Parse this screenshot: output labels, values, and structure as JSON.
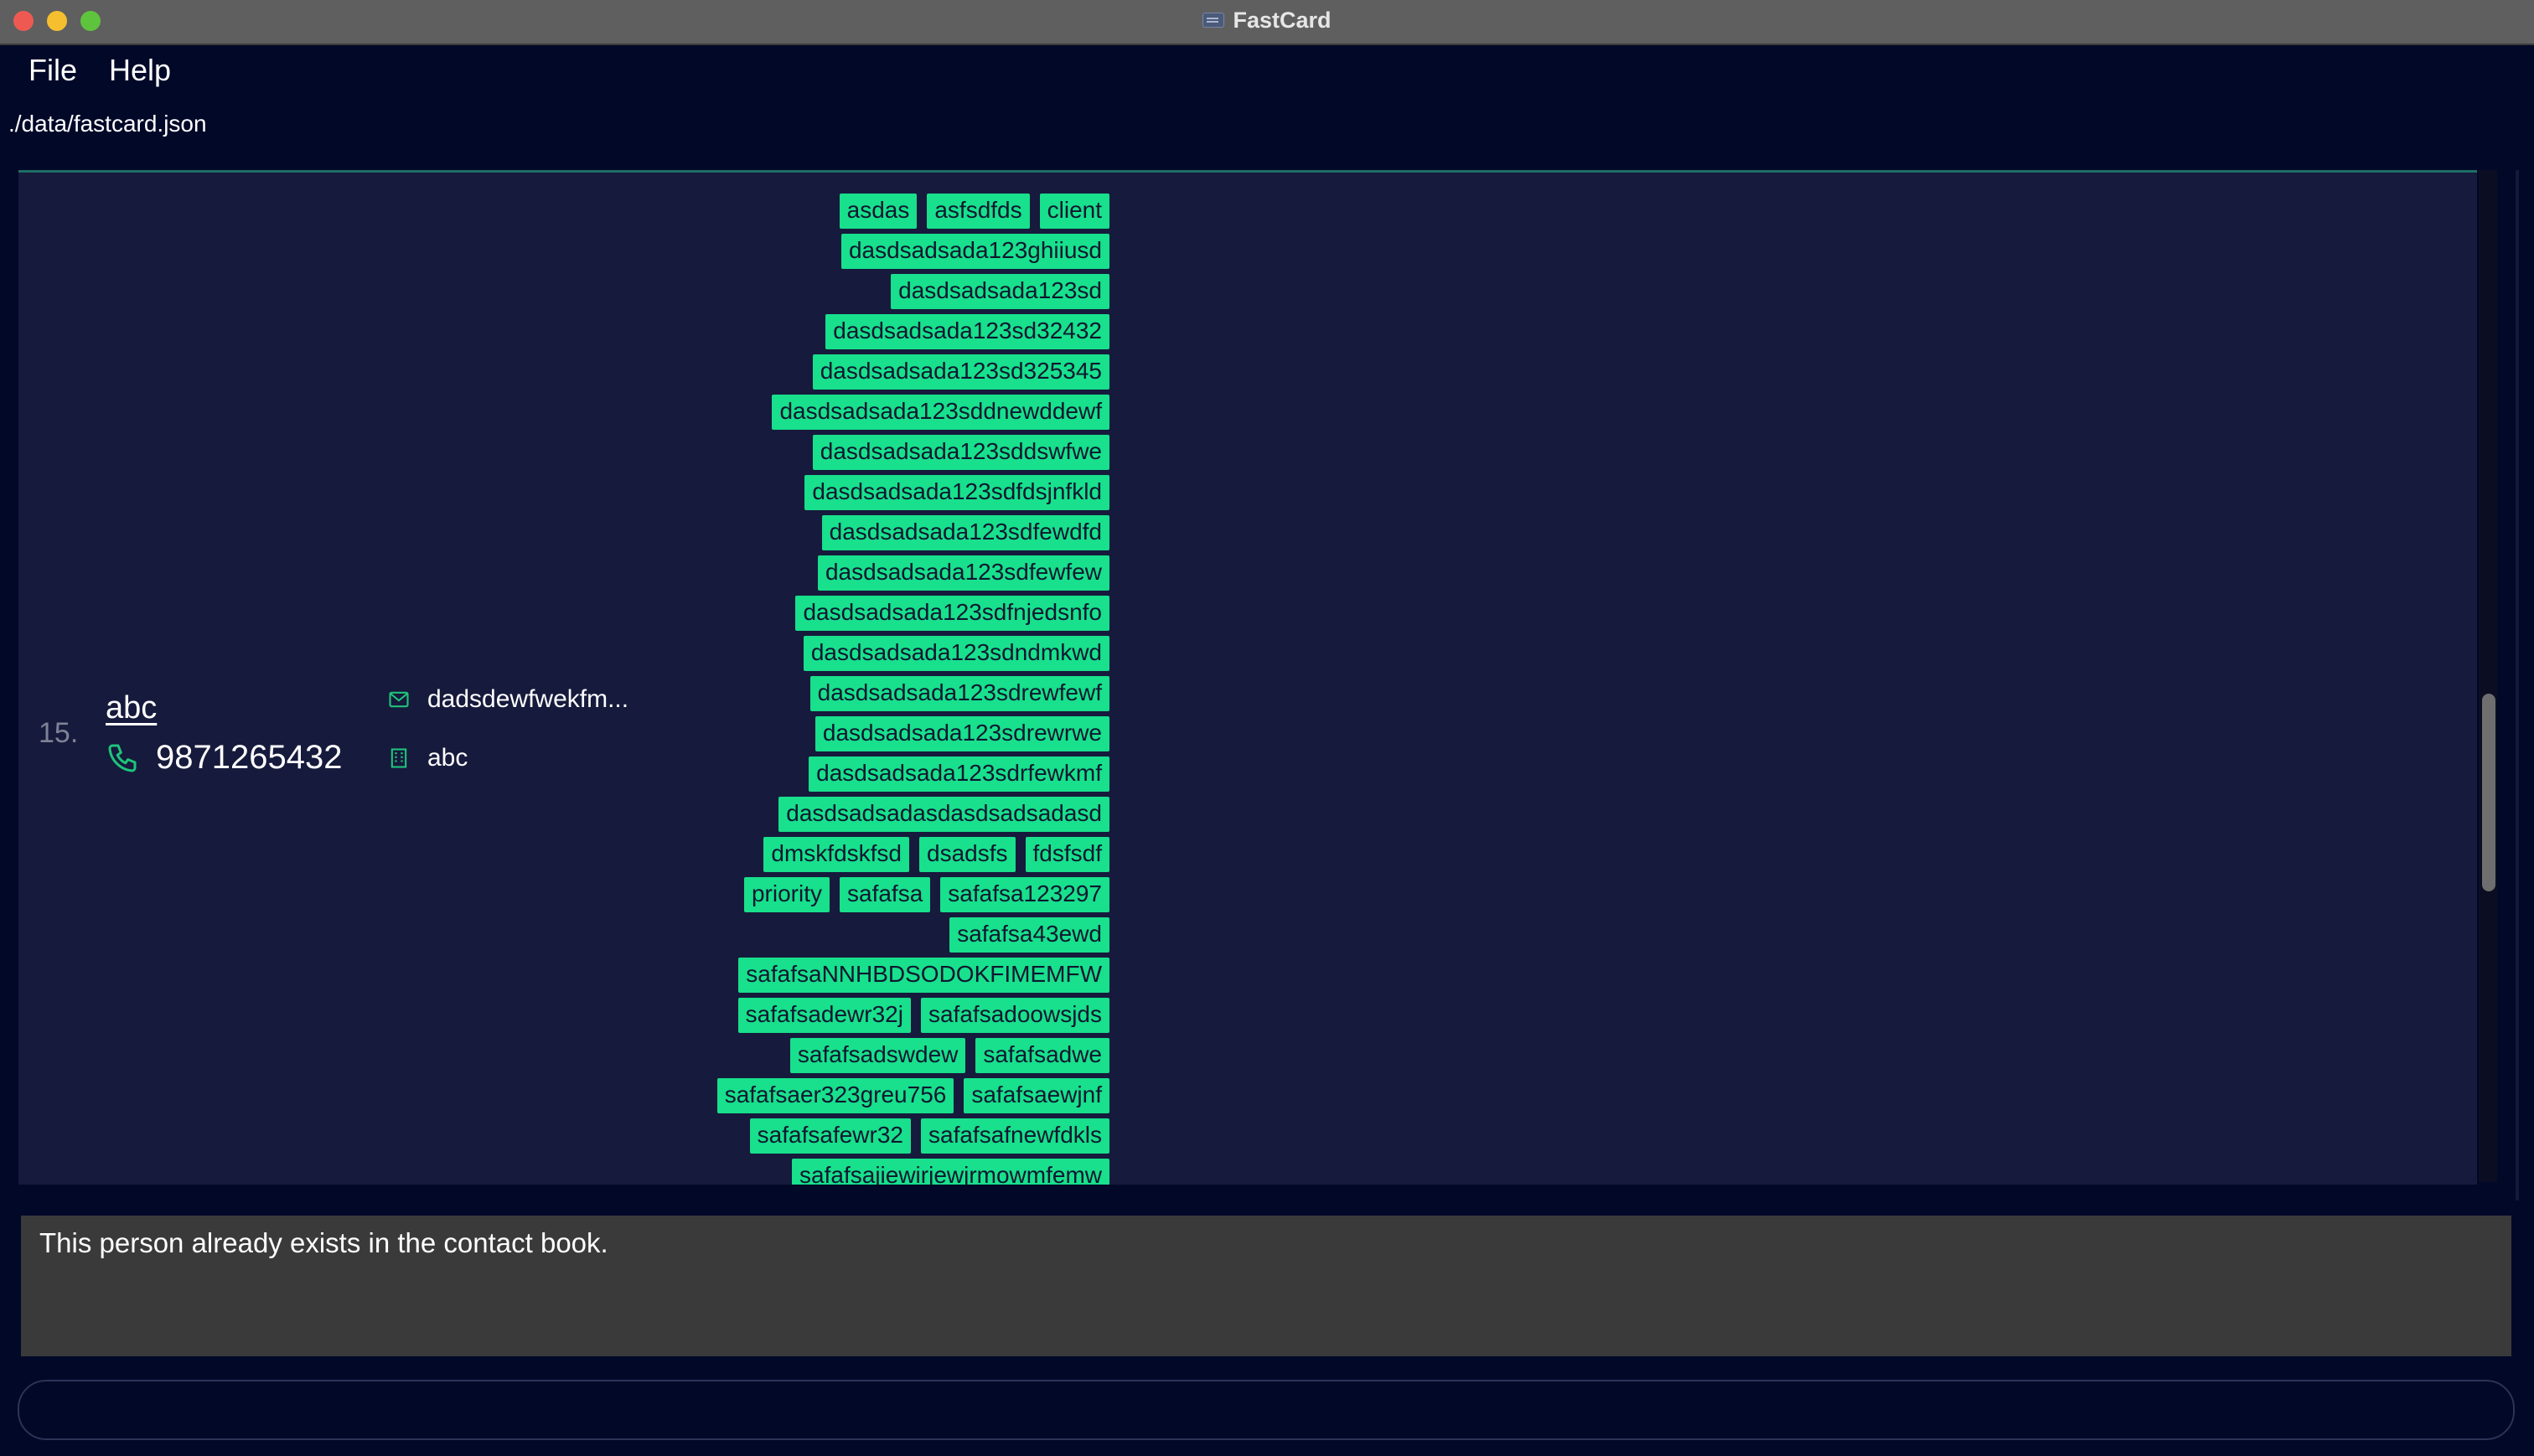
{
  "window": {
    "title": "FastCard",
    "app_icon": "contact-card-icon"
  },
  "menu": [
    {
      "label": "File"
    },
    {
      "label": "Help"
    }
  ],
  "status": {
    "file_path": "./data/fastcard.json"
  },
  "person_card": {
    "index": "15.",
    "name": "abc",
    "phone": "9871265432",
    "email": "dadsdewfwekfm...",
    "company": "abc",
    "icons": {
      "phone": "phone-icon",
      "email": "mail-icon",
      "company": "building-icon"
    },
    "tag_rows": [
      [
        "asdas",
        "asfsdfds",
        "client"
      ],
      [
        "dasdsadsada123ghiiusd"
      ],
      [
        "dasdsadsada123sd"
      ],
      [
        "dasdsadsada123sd32432"
      ],
      [
        "dasdsadsada123sd325345"
      ],
      [
        "dasdsadsada123sddnewddewf"
      ],
      [
        "dasdsadsada123sddswfwe"
      ],
      [
        "dasdsadsada123sdfdsjnfkld"
      ],
      [
        "dasdsadsada123sdfewdfd"
      ],
      [
        "dasdsadsada123sdfewfew"
      ],
      [
        "dasdsadsada123sdfnjedsnfo"
      ],
      [
        "dasdsadsada123sdndmkwd"
      ],
      [
        "dasdsadsada123sdrewfewf"
      ],
      [
        "dasdsadsada123sdrewrwe"
      ],
      [
        "dasdsadsada123sdrfewkmf"
      ],
      [
        "dasdsadsadasdasdsadsadasd"
      ],
      [
        "dmskfdskfsd",
        "dsadsfs",
        "fdsfsdf"
      ],
      [
        "priority",
        "safafsa",
        "safafsa123297"
      ],
      [
        "safafsa43ewd"
      ],
      [
        "safafsaNNHBDSODOKFIMEMFW"
      ],
      [
        "safafsadewr32j",
        "safafsadoowsjds"
      ],
      [
        "safafsadswdew",
        "safafsadwe"
      ],
      [
        "safafsaer323greu756",
        "safafsaewjnf"
      ],
      [
        "safafsafewr32",
        "safafsafnewfdkls"
      ],
      [
        "safafsajiewirjewjrmowmfemw"
      ]
    ]
  },
  "result": {
    "message": "This person already exists in the contact book."
  },
  "command": {
    "value": "",
    "placeholder": ""
  },
  "colors": {
    "tag_bg": "#18e08c",
    "icon_green": "#1ec47a",
    "panel_bg": "#161a3c",
    "window_bg": "#020828"
  }
}
